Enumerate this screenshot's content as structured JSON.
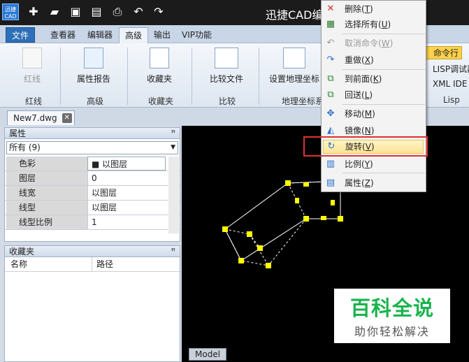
{
  "window": {
    "title": "迅捷CAD编"
  },
  "app": {
    "logo_text": "迅捷\nCAD"
  },
  "quick_access": [
    "new",
    "open",
    "save",
    "save-as",
    "print",
    "undo",
    "redo"
  ],
  "tabs": [
    {
      "label": "文件",
      "kind": "file"
    },
    {
      "label": "查看器"
    },
    {
      "label": "编辑器"
    },
    {
      "label": "高级",
      "active": true
    },
    {
      "label": "输出"
    },
    {
      "label": "VIP功能"
    }
  ],
  "ribbon": {
    "btn_redline": "红线",
    "grp_redline": "红线",
    "btn_attr_report": "属性报告",
    "grp_advanced": "高级",
    "btn_favorites": "收藏夹",
    "grp_favorites": "收藏夹",
    "btn_compare": "比较文件",
    "grp_compare": "比较",
    "btn_geo": "设置地理坐标",
    "grp_geo": "地理坐标系",
    "btn_cmdline": "命令行",
    "btn_lisp_debug": "LISP调试器",
    "btn_xml_ide": "XML IDE",
    "grp_lisp": "Lisp"
  },
  "doc_tab": {
    "name": "New7.dwg",
    "close": "✕"
  },
  "properties": {
    "title": "属性",
    "pin": "ꟸ",
    "filter": "所有 (9)",
    "rows": [
      {
        "name": "色彩",
        "value": "■ 以图层"
      },
      {
        "name": "图层",
        "value": "0"
      },
      {
        "name": "线宽",
        "value": "以图层"
      },
      {
        "name": "线型",
        "value": "以图层"
      },
      {
        "name": "线型比例",
        "value": "1"
      }
    ]
  },
  "favorites": {
    "title": "收藏夹",
    "pin": "ꟸ",
    "col_name": "名称",
    "col_path": "路径"
  },
  "canvas": {
    "model_tab": "Model"
  },
  "watermark": {
    "main": "百科全说",
    "sub": "助你轻松解决"
  },
  "context_menu": {
    "items": [
      {
        "label": "删除",
        "key": "T",
        "icon": "delete-icon"
      },
      {
        "label": "选择所有",
        "key": "U",
        "icon": "select-all-icon"
      },
      {
        "label": "取消命令",
        "key": "W",
        "icon": "cancel-icon",
        "disabled": true
      },
      {
        "label": "重做",
        "key": "X",
        "icon": "redo-icon"
      },
      {
        "label": "到前面",
        "key": "K",
        "icon": "bring-front-icon"
      },
      {
        "label": "回送",
        "key": "L",
        "icon": "send-back-icon"
      },
      {
        "label": "移动",
        "key": "M",
        "icon": "move-icon"
      },
      {
        "label": "镜像",
        "key": "N",
        "icon": "mirror-icon"
      },
      {
        "label": "旋转",
        "key": "V",
        "icon": "rotate-icon",
        "highlighted": true
      },
      {
        "label": "比例",
        "key": "Y",
        "icon": "scale-icon"
      },
      {
        "label": "属性",
        "key": "Z",
        "icon": "properties-icon"
      }
    ]
  },
  "colors": {
    "accent": "#2e6fb9",
    "highlight_frame": "#e03030",
    "grip": "#ffff00",
    "watermark_green": "#19b34d"
  }
}
